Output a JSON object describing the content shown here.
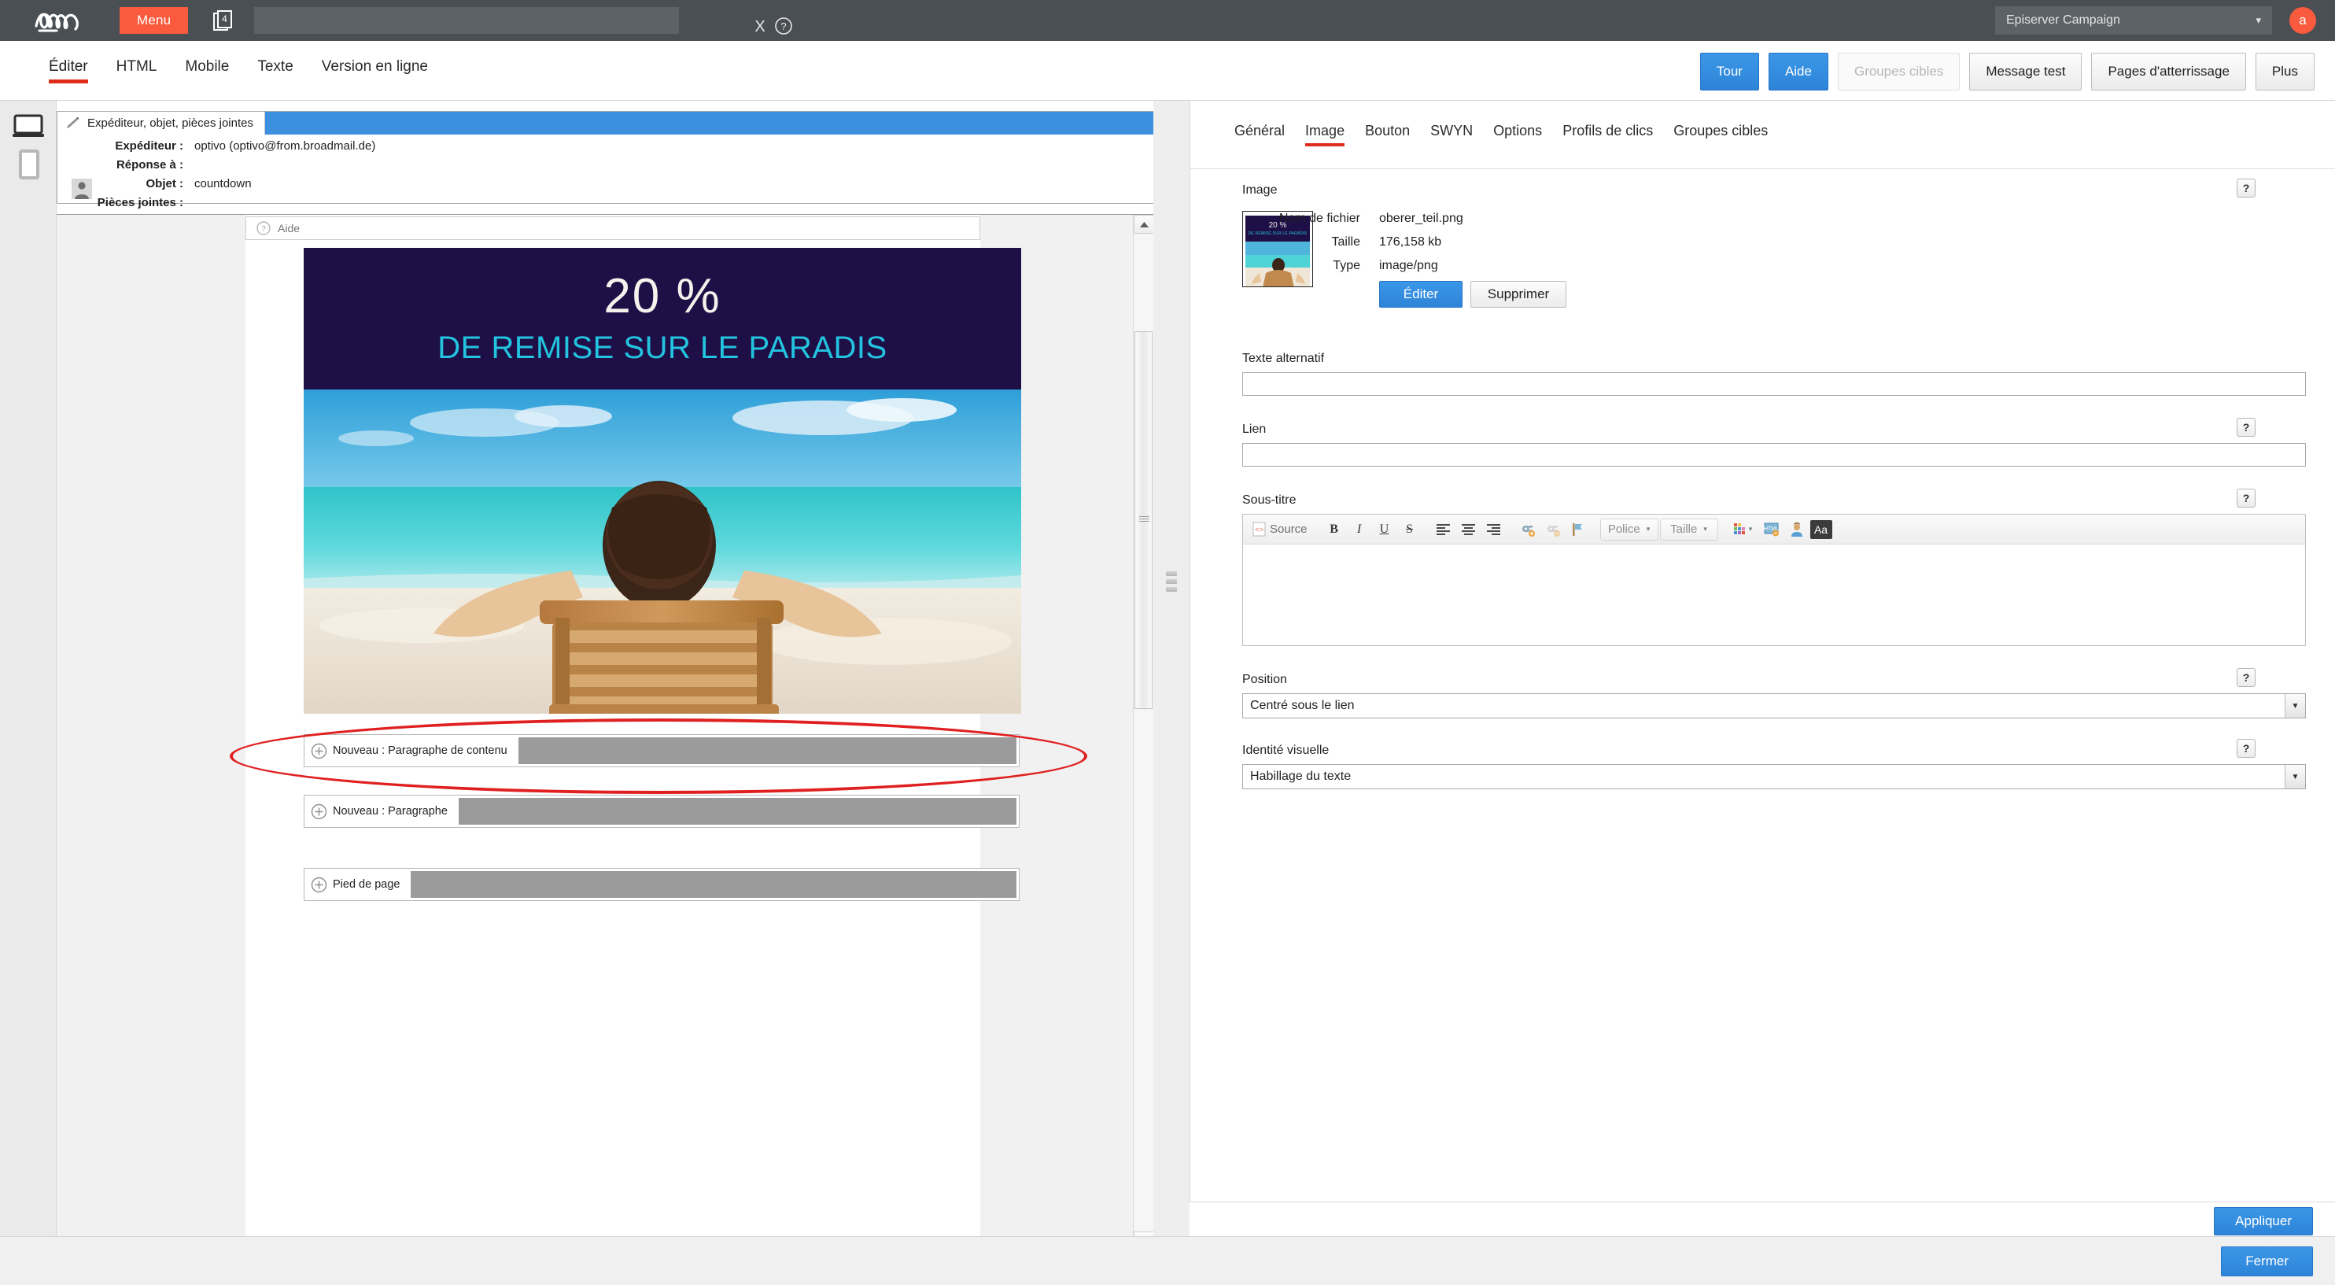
{
  "topbar": {
    "logo_alt": "Episerver",
    "menu_label": "Menu",
    "copy_badge": "4",
    "search_value": "",
    "search_placeholder": "",
    "clear_label": "X",
    "account": "Episerver Campaign",
    "avatar_initial": "a"
  },
  "tabbar": {
    "tabs": [
      {
        "label": "Éditer",
        "active": true
      },
      {
        "label": "HTML",
        "active": false
      },
      {
        "label": "Mobile",
        "active": false
      },
      {
        "label": "Texte",
        "active": false
      },
      {
        "label": "Version en ligne",
        "active": false
      }
    ],
    "actions": [
      {
        "label": "Tour",
        "style": "primary"
      },
      {
        "label": "Aide",
        "style": "primary"
      },
      {
        "label": "Groupes cibles",
        "style": "disabled"
      },
      {
        "label": "Message test",
        "style": "default"
      },
      {
        "label": "Pages d'atterrissage",
        "style": "default"
      },
      {
        "label": "Plus",
        "style": "default"
      }
    ]
  },
  "leftrail": {
    "desktop_icon": "desktop-preview-icon",
    "mobile_icon": "mobile-preview-icon"
  },
  "sender": {
    "tab_label": "Expéditeur, objet, pièces jointes",
    "rows": [
      {
        "label": "Expéditeur :",
        "value": "optivo (optivo@from.broadmail.de)"
      },
      {
        "label": "Réponse à :",
        "value": ""
      },
      {
        "label": "Objet :",
        "value": "countdown"
      },
      {
        "label": "Pièces jointes :",
        "value": ""
      }
    ]
  },
  "preview": {
    "aide_label": "Aide",
    "banner": {
      "percent": "20 %",
      "subtitle": "DE REMISE SUR LE PARADIS",
      "bg_color": "#1e1047",
      "percent_color": "#f4f2ec",
      "subtitle_color": "#23c4e0"
    },
    "blocks": [
      {
        "label": "Nouveau : Paragraphe de contenu",
        "highlighted": true
      },
      {
        "label": "Nouveau : Paragraphe",
        "highlighted": false
      },
      {
        "label": "Pied de page",
        "highlighted": false
      }
    ],
    "annotation_color": "#e02020"
  },
  "panel": {
    "tabs": [
      {
        "label": "Général",
        "active": false
      },
      {
        "label": "Image",
        "active": true
      },
      {
        "label": "Bouton",
        "active": false
      },
      {
        "label": "SWYN",
        "active": false
      },
      {
        "label": "Options",
        "active": false
      },
      {
        "label": "Profils de clics",
        "active": false
      },
      {
        "label": "Groupes cibles",
        "active": false
      }
    ],
    "image_section": {
      "title": "Image",
      "help": "?",
      "thumbnail": {
        "percent": "20 %",
        "subtitle": "DE REMISE SUR LE PARADIS"
      },
      "meta": [
        {
          "key": "Nom de fichier",
          "value": "oberer_teil.png"
        },
        {
          "key": "Taille",
          "value": "176,158 kb"
        },
        {
          "key": "Type",
          "value": "image/png"
        }
      ],
      "edit_label": "Éditer",
      "delete_label": "Supprimer"
    },
    "alt_text": {
      "label": "Texte alternatif",
      "value": "",
      "placeholder": ""
    },
    "link": {
      "label": "Lien",
      "value": "",
      "placeholder": "",
      "help": "?"
    },
    "subtitle": {
      "label": "Sous-titre",
      "help": "?",
      "toolbar": [
        {
          "name": "source-button",
          "label": "Source"
        },
        {
          "name": "bold-button",
          "label": "B"
        },
        {
          "name": "italic-button",
          "label": "I"
        },
        {
          "name": "underline-button",
          "label": "U"
        },
        {
          "name": "strikethrough-button",
          "label": "S"
        },
        {
          "name": "align-left-button",
          "label": "≡"
        },
        {
          "name": "align-center-button",
          "label": "≡"
        },
        {
          "name": "align-right-button",
          "label": "≡"
        },
        {
          "name": "insert-link-button",
          "label": "⚭"
        },
        {
          "name": "unlink-button",
          "label": "⚭"
        },
        {
          "name": "anchor-button",
          "label": "⚑"
        }
      ],
      "font_combo": "Police",
      "size_combo": "Taille",
      "color_button": "text-color-icon",
      "html_button": "html-snippet-icon",
      "personalize_button": "personalization-icon",
      "case_button": "Aa",
      "content": ""
    },
    "position": {
      "label": "Position",
      "help": "?",
      "value": "Centré sous le lien"
    },
    "visual_identity": {
      "label": "Identité visuelle",
      "help": "?",
      "value": "Habillage du texte"
    },
    "apply_label": "Appliquer"
  },
  "bottom": {
    "close_label": "Fermer"
  },
  "colors": {
    "topbar_bg": "#4a4f54",
    "accent_orange": "#fa5a3d",
    "accent_red": "#e02c1b",
    "primary_blue": "#3c97e8",
    "selected_blue": "#3d8fe0"
  }
}
